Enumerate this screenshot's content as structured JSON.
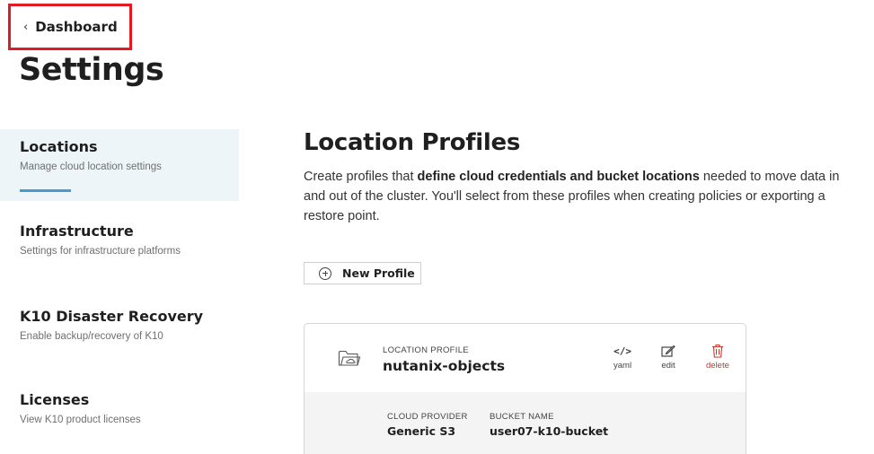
{
  "header": {
    "back_label": "Dashboard",
    "page_title": "Settings"
  },
  "sidebar": {
    "items": [
      {
        "title": "Locations",
        "subtitle": "Manage cloud location settings",
        "active": true
      },
      {
        "title": "Infrastructure",
        "subtitle": "Settings for infrastructure platforms",
        "active": false
      },
      {
        "title": "K10 Disaster Recovery",
        "subtitle": "Enable backup/recovery of K10",
        "active": false
      },
      {
        "title": "Licenses",
        "subtitle": "View K10 product licenses",
        "active": false
      }
    ]
  },
  "main": {
    "title": "Location Profiles",
    "desc_pre": "Create profiles that ",
    "desc_bold": "define cloud credentials and bucket locations",
    "desc_post": " needed to move data in and out of the cluster. You'll select from these profiles when creating policies or exporting a restore point.",
    "new_profile_label": "New Profile",
    "profile": {
      "kind_label": "LOCATION PROFILE",
      "name": "nutanix-objects",
      "actions": {
        "yaml": "yaml",
        "edit": "edit",
        "delete": "delete"
      },
      "cloud_provider_label": "CLOUD PROVIDER",
      "cloud_provider": "Generic S3",
      "bucket_name_label": "BUCKET NAME",
      "bucket_name": "user07-k10-bucket"
    }
  },
  "colors": {
    "highlight_border": "#e21b23",
    "active_nav_bg": "#eef5f9",
    "active_nav_underline": "#4a9cc8",
    "delete_red": "#c0392b"
  },
  "icons": [
    "chevron-left-icon",
    "plus-circle-icon",
    "folder-cloud-icon",
    "code-icon",
    "edit-icon",
    "trash-icon"
  ]
}
